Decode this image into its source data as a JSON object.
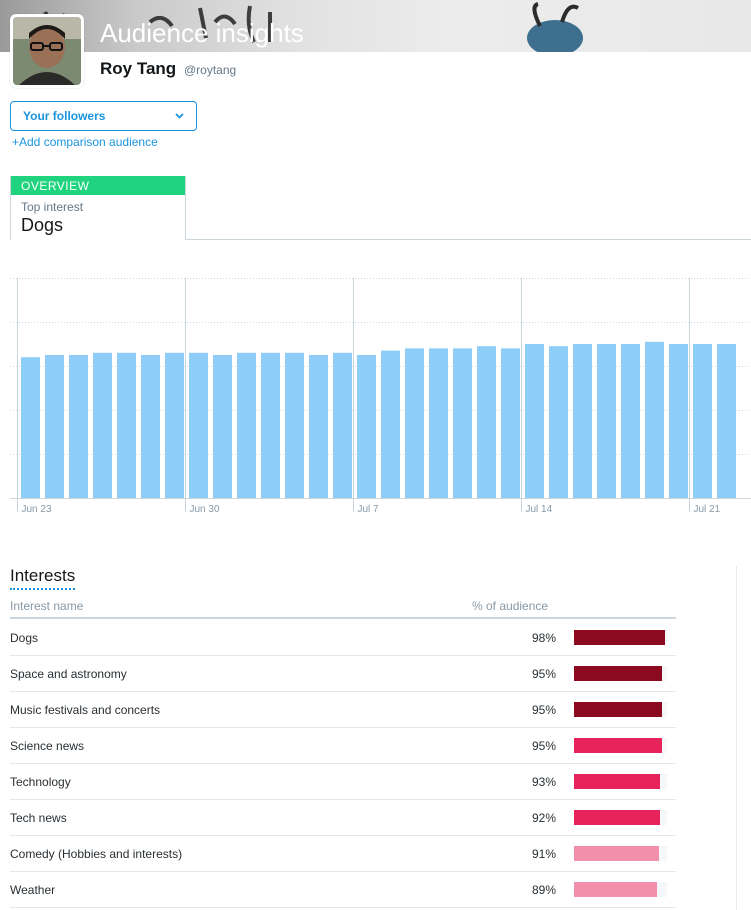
{
  "header": {
    "title": "Audience insights",
    "user_name": "Roy Tang",
    "user_handle": "@roytang"
  },
  "audience_selector": {
    "selected": "Your followers",
    "add_comparison": "+Add comparison audience"
  },
  "overview": {
    "tag": "OVERVIEW",
    "label": "Top interest",
    "value": "Dogs"
  },
  "chart_data": {
    "type": "bar",
    "bar_color": "#8ecdf7",
    "x_tick_labels": [
      "Jun 23",
      "Jun 30",
      "Jul 7",
      "Jul 14",
      "Jul 21"
    ],
    "x_tick_bar_index": [
      0,
      7,
      14,
      21,
      28
    ],
    "values": [
      64,
      65,
      65,
      66,
      66,
      65,
      66,
      66,
      65,
      66,
      66,
      66,
      65,
      66,
      65,
      67,
      68,
      68,
      68,
      69,
      68,
      70,
      69,
      70,
      70,
      70,
      71,
      70,
      70,
      70
    ],
    "ylim": [
      0,
      100
    ],
    "grid": true
  },
  "interests": {
    "title": "Interests",
    "col_name": "Interest name",
    "col_pct": "% of audience",
    "rows": [
      {
        "name": "Dogs",
        "pct": "98%",
        "value": 98,
        "color": "#8b0a1f"
      },
      {
        "name": "Space and astronomy",
        "pct": "95%",
        "value": 95,
        "color": "#8b0a1f"
      },
      {
        "name": "Music festivals and concerts",
        "pct": "95%",
        "value": 95,
        "color": "#8b0a1f"
      },
      {
        "name": "Science news",
        "pct": "95%",
        "value": 95,
        "color": "#e8225a"
      },
      {
        "name": "Technology",
        "pct": "93%",
        "value": 93,
        "color": "#e8225a"
      },
      {
        "name": "Tech news",
        "pct": "92%",
        "value": 92,
        "color": "#e8225a"
      },
      {
        "name": "Comedy (Hobbies and interests)",
        "pct": "91%",
        "value": 91,
        "color": "#f28fab"
      },
      {
        "name": "Weather",
        "pct": "89%",
        "value": 89,
        "color": "#f28fab"
      }
    ]
  }
}
